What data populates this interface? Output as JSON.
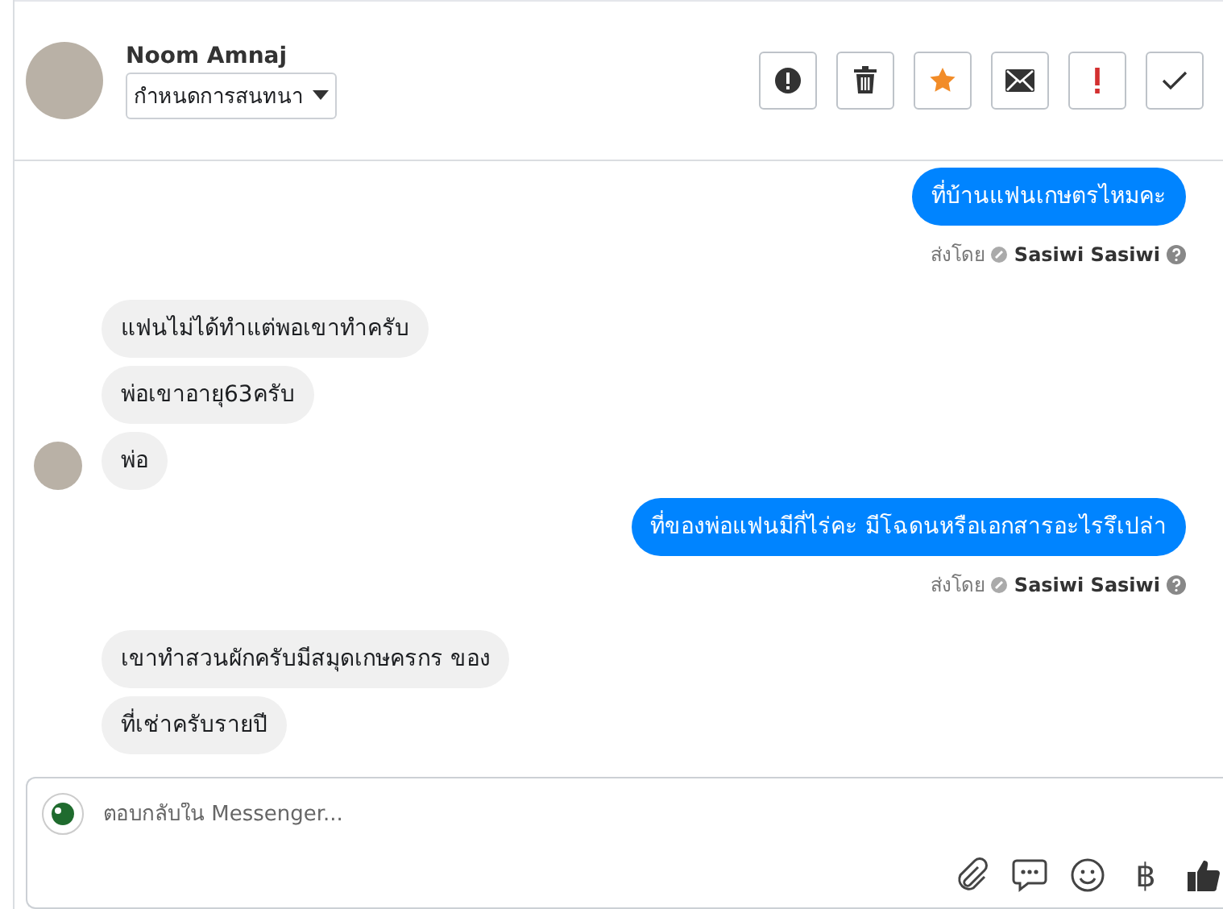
{
  "header": {
    "name": "Noom Amnaj",
    "dropdown_label": "กำหนดการสนทนา",
    "actions": [
      {
        "kind": "spam"
      },
      {
        "kind": "delete"
      },
      {
        "kind": "star"
      },
      {
        "kind": "unread"
      },
      {
        "kind": "important"
      },
      {
        "kind": "done"
      }
    ]
  },
  "messages": [
    {
      "kind": "sent",
      "text": "ที่บ้านแฟนเกษตรไหมคะ",
      "sent_by_label": "ส่งโดย",
      "sender": "Sasiwi Sasiwi"
    },
    {
      "kind": "received",
      "text": "แฟนไม่ได้ทำแต่พอเขาทำครับ",
      "show_avatar": false
    },
    {
      "kind": "received",
      "text": "พ่อเขาอายุ63ครับ",
      "show_avatar": false
    },
    {
      "kind": "received",
      "text": "พ่อ",
      "show_avatar": true
    },
    {
      "kind": "sent",
      "text": "ที่ของพ่อแฟนมีกี่ไร่คะ มีโฉดนหรือเอกสารอะไรรึเปล่า",
      "sent_by_label": "ส่งโดย",
      "sender": "Sasiwi Sasiwi"
    },
    {
      "kind": "received",
      "text": "เขาทำสวนผักครับมีสมุดเกษครกร ของ",
      "show_avatar": false
    },
    {
      "kind": "received",
      "text": "ที่เช่าครับรายปี",
      "show_avatar": false
    }
  ],
  "composer": {
    "placeholder": "ตอบกลับใน Messenger...",
    "tools": [
      {
        "kind": "attach"
      },
      {
        "kind": "comment"
      },
      {
        "kind": "emoji"
      },
      {
        "kind": "glyph",
        "glyph": "฿"
      },
      {
        "kind": "like"
      }
    ]
  }
}
